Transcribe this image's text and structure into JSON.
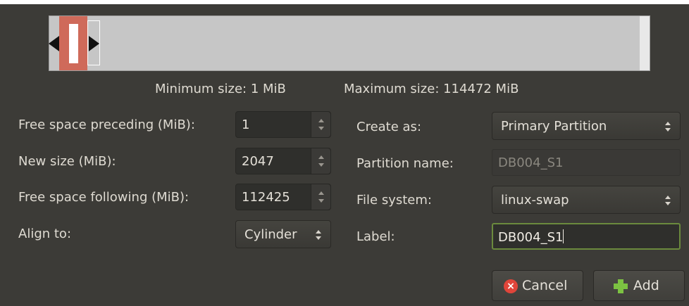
{
  "partition_bar": {
    "min_label": "Minimum size: 1 MiB",
    "max_label": "Maximum size: 114472 MiB"
  },
  "left_form": {
    "free_preceding": {
      "label": "Free space preceding (MiB):",
      "value": "1"
    },
    "new_size": {
      "label": "New size (MiB):",
      "value": "2047"
    },
    "free_following": {
      "label": "Free space following (MiB):",
      "value": "112425"
    },
    "align_to": {
      "label": "Align to:",
      "value": "Cylinder"
    }
  },
  "right_form": {
    "create_as": {
      "label": "Create as:",
      "value": "Primary Partition"
    },
    "partition_name": {
      "label": "Partition name:",
      "value": "DB004_S1"
    },
    "file_system": {
      "label": "File system:",
      "value": "linux-swap"
    },
    "fs_label": {
      "label": "Label:",
      "value": "DB004_S1"
    }
  },
  "buttons": {
    "cancel": {
      "label": "Cancel",
      "icon": "cancel-icon",
      "color": "#e0453a"
    },
    "add": {
      "label": "Add",
      "icon": "add-icon",
      "color": "#7cc242"
    }
  },
  "colors": {
    "background": "#3c3b37",
    "partition": "#cf6a5a",
    "unallocated": "#c6c6c6",
    "focus_border": "#6b8a3d"
  }
}
